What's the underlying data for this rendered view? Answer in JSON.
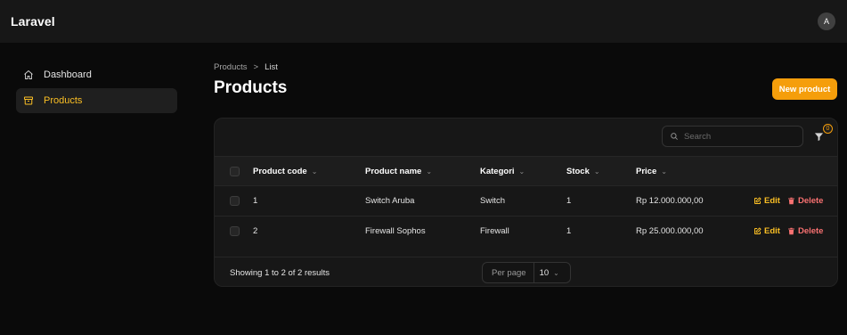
{
  "app": {
    "title": "Laravel",
    "user_initial": "A"
  },
  "sidebar": {
    "items": [
      {
        "label": "Dashboard",
        "icon": "home-icon",
        "active": false
      },
      {
        "label": "Products",
        "icon": "archive-box-icon",
        "active": true
      }
    ]
  },
  "breadcrumb": {
    "items": [
      "Products",
      "List"
    ],
    "separator": ">"
  },
  "page": {
    "title": "Products",
    "new_button_label": "New product"
  },
  "table": {
    "search_placeholder": "Search",
    "filter_count": "0",
    "columns": [
      "Product code",
      "Product name",
      "Kategori",
      "Stock",
      "Price"
    ],
    "sort_indicator": "⌄",
    "rows": [
      {
        "code": "1",
        "name": "Switch Aruba",
        "category": "Switch",
        "stock": "1",
        "price": "Rp 12.000.000,00"
      },
      {
        "code": "2",
        "name": "Firewall Sophos",
        "category": "Firewall",
        "stock": "1",
        "price": "Rp 25.000.000,00"
      }
    ],
    "actions": {
      "edit": "Edit",
      "delete": "Delete"
    },
    "summary": "Showing 1 to 2 of 2 results",
    "per_page_label": "Per page",
    "per_page_value": "10"
  },
  "colors": {
    "accent": "#f59e0b",
    "danger": "#f87171",
    "background": "#0a0a0a",
    "surface": "#171717"
  }
}
